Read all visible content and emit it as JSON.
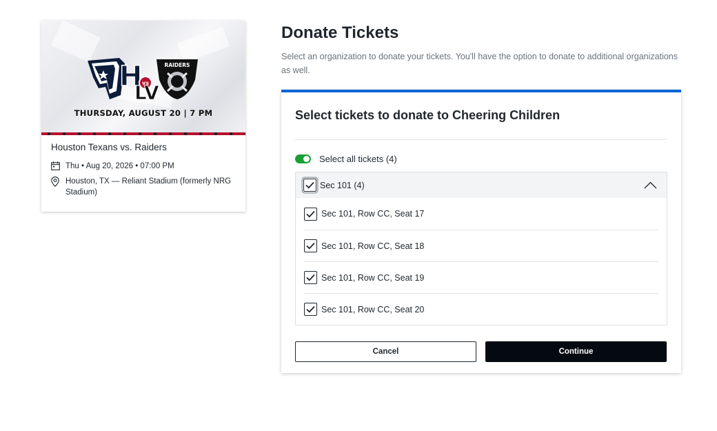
{
  "event": {
    "image": {
      "team_home_abbr": "H",
      "team_away_abbr": "LV",
      "team_away_name": "RAIDERS",
      "vs_label": "vs",
      "date_banner": "THURSDAY, AUGUST 20 | 7 PM",
      "colors": {
        "home": "#b8102e",
        "home_dark": "#0c1c3a",
        "away": "#111111"
      }
    },
    "title": "Houston Texans vs. Raiders",
    "date_time": "Thu • Aug 20, 2026 • 07:00 PM",
    "venue": "Houston, TX — Reliant Stadium (formerly NRG Stadium)",
    "date_icon": "calendar-icon",
    "venue_icon": "location-pin-icon"
  },
  "page": {
    "title": "Donate Tickets",
    "description": "Select an organization to donate your tickets. You'll have the option to donate to additional organizations as well."
  },
  "panel": {
    "heading": "Select tickets to donate to Cheering Children",
    "select_all": {
      "label": "Select all tickets (4)",
      "on": true
    },
    "section": {
      "label": "Sec 101 (4)",
      "checked": true,
      "expanded": true,
      "seats": [
        {
          "label": "Sec 101, Row CC, Seat 17",
          "checked": true
        },
        {
          "label": "Sec 101, Row CC, Seat 18",
          "checked": true
        },
        {
          "label": "Sec 101, Row CC, Seat 19",
          "checked": true
        },
        {
          "label": "Sec 101, Row CC, Seat 20",
          "checked": true
        }
      ]
    },
    "cancel_label": "Cancel",
    "continue_label": "Continue"
  },
  "colors": {
    "accent": "#0b66d6",
    "toggle_on": "#18a133",
    "primary_button": "#050a10"
  }
}
